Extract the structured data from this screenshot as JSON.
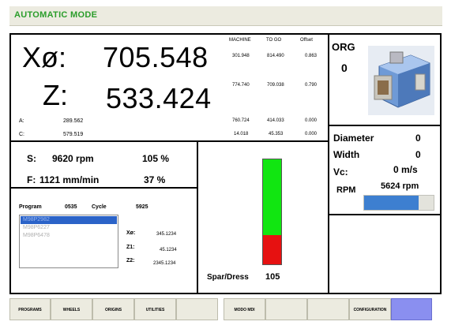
{
  "title": "AUTOMATIC MODE",
  "axes": {
    "col_headers": {
      "machine": "MACHINE",
      "togo": "TO GO",
      "offset": "Offset"
    },
    "x": {
      "label": "Xø:",
      "value": "705.548",
      "machine": "301.948",
      "togo": "814.490",
      "offset": "0.863"
    },
    "z": {
      "label": "Z:",
      "value": "533.424",
      "machine": "774.740",
      "togo": "709.038",
      "offset": "0.790"
    },
    "a": {
      "label": "A:",
      "value": "289.562",
      "machine": "760.724",
      "togo": "414.033",
      "offset": "0.000"
    },
    "c": {
      "label": "C:",
      "value": "579.519",
      "machine": "14.018",
      "togo": "45.353",
      "offset": "0.000"
    }
  },
  "org": {
    "label": "ORG",
    "value": "0"
  },
  "spindle": {
    "s_label": "S:",
    "s_value": "9620 rpm",
    "s_pct": "105 %",
    "f_label": "F:",
    "f_value": "1121 mm/min",
    "f_pct": "37 %"
  },
  "program": {
    "program_label": "Program",
    "program_value": "0535",
    "cycle_label": "Cycle",
    "cycle_value": "5925",
    "list": [
      "M98P2982",
      "M98P6227",
      "M98P6478"
    ],
    "selected_index": 0,
    "x_label": "Xø:",
    "x_value": "345.1234",
    "z1_label": "Z1:",
    "z1_value": "45.1234",
    "z2_label": "Z2:",
    "z2_value": "2345.1234"
  },
  "spar": {
    "label": "Spar/Dress",
    "value": "105",
    "green_fraction": 0.72,
    "red_fraction": 0.28,
    "colors": {
      "green": "#11e611",
      "red": "#e61111"
    }
  },
  "wheel": {
    "diameter_label": "Diameter",
    "diameter_value": "0",
    "width_label": "Width",
    "width_value": "0",
    "vc_label": "Vc:",
    "vc_value": "0 m/s",
    "rpm_label": "RPM",
    "rpm_value": "5624 rpm",
    "rpm_fraction": 0.78,
    "bar_color": "#3d7fd0"
  },
  "buttons": {
    "programs": "PROGRAMS",
    "wheels": "WHEELS",
    "origins": "ORIGINS",
    "utilities": "UTILITIES",
    "mdi": "MODO MDI",
    "configuration": "CONFIGURATION"
  },
  "colors": {
    "title_text": "#2a9d2a",
    "title_bg": "#ecebe0",
    "accent_button": "#8a8ff0"
  }
}
